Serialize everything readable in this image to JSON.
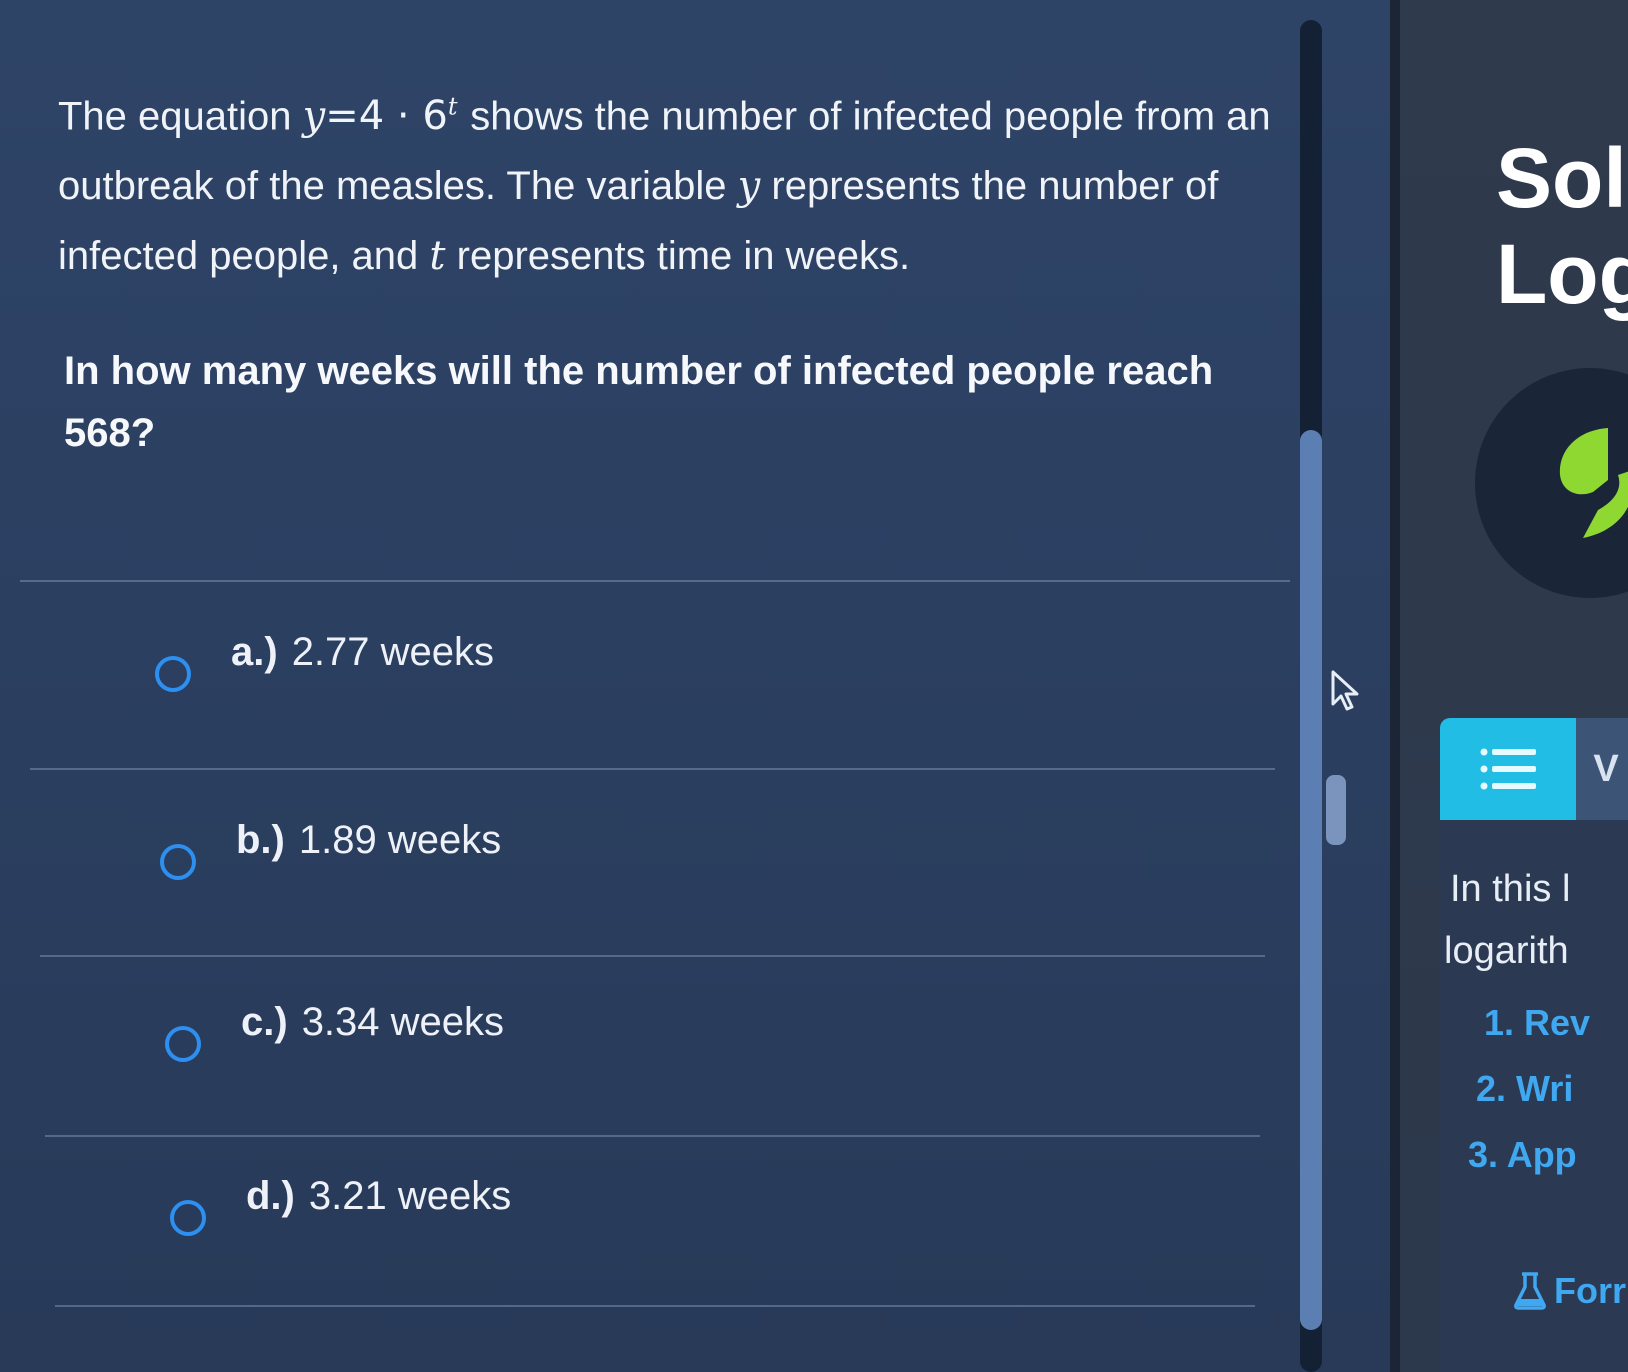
{
  "question": {
    "intro": "The equation",
    "equation_lhs": "y",
    "equation_eq": "=",
    "equation_base": "4 · 6",
    "equation_exp": "t",
    "part1": "shows the number of infected people from an outbreak of the measles. The variable",
    "var_y": "y",
    "part2": "represents the number of infected people, and",
    "var_t": "t",
    "part3": "represents time in weeks.",
    "prompt": "In how many weeks will the number of infected people reach 568?"
  },
  "options": [
    {
      "letter": "a.)",
      "text": "2.77 weeks"
    },
    {
      "letter": "b.)",
      "text": "1.89 weeks"
    },
    {
      "letter": "c.)",
      "text": "3.34 weeks"
    },
    {
      "letter": "d.)",
      "text": "3.21 weeks"
    }
  ],
  "side_panel": {
    "title_line1": "Sol",
    "title_line2": "Log",
    "tab_other_label": "V",
    "content_line1": "In this l",
    "content_line2": "logarith",
    "steps": [
      "1. Rev",
      "2. Wri",
      "3. App"
    ],
    "formula_link": "Forr"
  },
  "colors": {
    "accent_blue": "#2d8ff0",
    "tab_cyan": "#22bde4",
    "logo_green": "#8fd832"
  }
}
